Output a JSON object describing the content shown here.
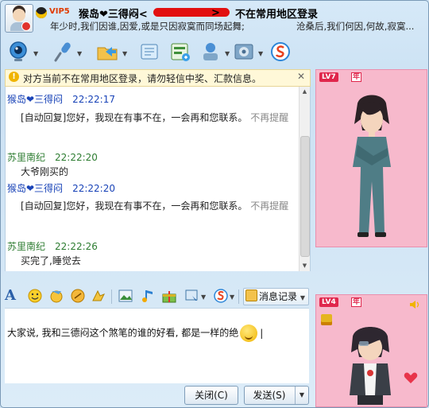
{
  "title": {
    "vip_badge": "VIP5",
    "contact_name": "猴岛❤三得闷<",
    "redacted_tail": ">",
    "status_text": "不在常用地区登录",
    "signature": "年少时,我们因谁,因爱,或是只因寂寞而同场起舞;",
    "signature_right": "沧桑后,我们何因,何故,寂寞..."
  },
  "toolbar": {
    "icons": [
      "webcam-icon",
      "microphone-icon",
      "folder-transfer-icon",
      "email-icon",
      "application-icon",
      "remote-assistance-icon",
      "settings-icon",
      "soso-icon"
    ]
  },
  "notice": {
    "icon": "!",
    "text": "对方当前不在常用地区登录，请勿轻信中奖、汇款信息。",
    "close": "✕"
  },
  "messages": [
    {
      "sender": "猴岛❤三得闷",
      "time": "22:22:17",
      "text": "[自动回复]您好，我现在有事不在，一会再和您联系。",
      "tail": "不再提醒",
      "type": "self"
    },
    {
      "sender": "苏里南纪",
      "time": "22:22:20",
      "text": "大爷刚买的",
      "type": "other"
    },
    {
      "sender": "猴岛❤三得闷",
      "time": "22:22:20",
      "text": "[自动回复]您好，我现在有事不在，一会再和您联系。",
      "tail": "不再提醒",
      "type": "self"
    },
    {
      "sender": "苏里南纪",
      "time": "22:22:26",
      "text": "买完了,睡觉去",
      "type": "other"
    }
  ],
  "format_bar": {
    "font_icon": "A",
    "message_record_label": "消息记录"
  },
  "input": {
    "text": "大家说, 我和三德闷这个煞笔的谁的好看, 都是一样的绝"
  },
  "buttons": {
    "close_label": "关闭(C)",
    "send_label": "发送(S)"
  },
  "show_top": {
    "level": "LV7",
    "year": "年"
  },
  "show_bottom": {
    "level": "LV4",
    "year": "年"
  },
  "colors": {
    "self_name": "#1a44b8",
    "other_name": "#2e7d32",
    "show_bg": "#f7b9cc",
    "redaction": "#e21010"
  }
}
